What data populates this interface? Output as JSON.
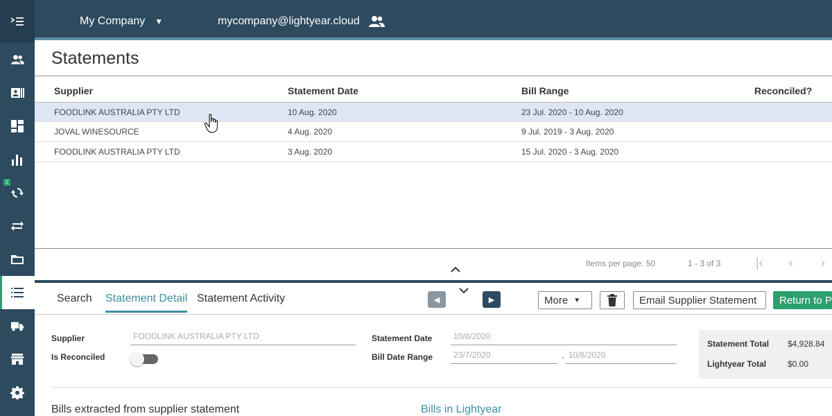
{
  "topbar": {
    "company": "My Company",
    "email": "mycompany@lightyear.cloud"
  },
  "sidebar": {
    "items": [
      {
        "icon": "users-icon"
      },
      {
        "icon": "contact-card-icon"
      },
      {
        "icon": "dashboard-icon"
      },
      {
        "icon": "bar-chart-icon"
      },
      {
        "icon": "sync-icon",
        "badge": "2"
      },
      {
        "icon": "transfer-icon"
      },
      {
        "icon": "folder-icon"
      },
      {
        "icon": "list-icon",
        "active": true
      },
      {
        "icon": "truck-icon"
      },
      {
        "icon": "store-icon"
      },
      {
        "icon": "gear-icon"
      }
    ]
  },
  "page": {
    "title": "Statements"
  },
  "grid": {
    "columns": [
      "Supplier",
      "Statement Date",
      "Bill Range",
      "Reconciled?"
    ],
    "rows": [
      {
        "supplier": "FOODLINK AUSTRALIA PTY LTD",
        "date": "10 Aug. 2020",
        "range": "23 Jul. 2020 - 10 Aug. 2020",
        "reconciled": ""
      },
      {
        "supplier": "JOVAL WINESOURCE",
        "date": "4 Aug. 2020",
        "range": "9 Jul. 2019 - 3 Aug. 2020",
        "reconciled": ""
      },
      {
        "supplier": "FOODLINK AUSTRALIA PTY LTD",
        "date": "3 Aug. 2020",
        "range": "15 Jul. 2020 - 3 Aug. 2020",
        "reconciled": ""
      }
    ],
    "selected_row": 0
  },
  "pager": {
    "items_per_page": "Items per page: 50",
    "range": "1 - 3 of 3"
  },
  "tabs": {
    "search": "Search",
    "detail": "Statement Detail",
    "activity": "Statement Activity"
  },
  "toolbar": {
    "more": "More",
    "email_statement": "Email Supplier Statement",
    "return": "Return to P"
  },
  "detail": {
    "supplier_label": "Supplier",
    "supplier_value": "FOODLINK AUSTRALIA PTY LTD",
    "reconciled_label": "Is Reconciled",
    "reconciled": false,
    "statement_date_label": "Statement Date",
    "statement_date_value": "10/8/2020",
    "bill_range_label": "Bill Date Range",
    "bill_range_from": "23/7/2020",
    "bill_range_sep": "-",
    "bill_range_to": "10/8/2020",
    "statement_total_label": "Statement Total",
    "statement_total_value": "$4,928.84",
    "lightyear_total_label": "Lightyear Total",
    "lightyear_total_value": "$0.00",
    "bills_extracted": "Bills extracted from supplier statement",
    "bills_in_lightyear": "Bills in Lightyear"
  },
  "colors": {
    "nav_bg": "#2d4a5e",
    "accent": "#3f8ea3",
    "green": "#2c9f6e",
    "selected_row": "#dde6f5"
  }
}
